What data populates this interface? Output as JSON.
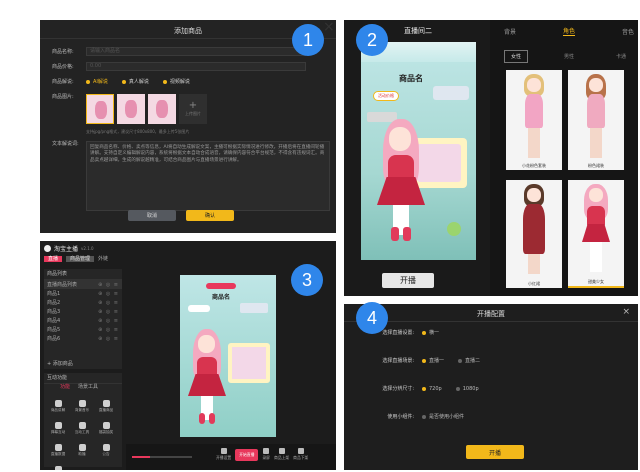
{
  "panel1": {
    "title": "添加商品",
    "name_label": "商品名称:",
    "name_placeholder": "请输入商品名",
    "price_label": "商品价格:",
    "price_placeholder": "0.00",
    "explain_label": "商品解说:",
    "explain_options": [
      "AI解说",
      "真人解说",
      "视频解说"
    ],
    "image_label": "商品图片:",
    "upload_label": "上传图片",
    "image_hint": "支持jpg/png格式，建议尺寸800x800，最多上传5张图片",
    "text_label": "文本解说词:",
    "text_content": "回复商品名称、价格、卖点等信息，AI将自动生成解说文案，主播可根据实际情况进行修改，开播后将在直播间轮播讲解。支持自定义编辑解说内容，系统将根据文本自动合成语音，请确保内容符合平台规范，不得含有违规词汇。商品卖点越详细，生成的解说越精准，可结合商品图片与直播场景进行讲解。",
    "cancel": "取消",
    "confirm": "确认",
    "close_icon": "close-icon"
  },
  "panel2": {
    "room_title": "直播间二",
    "product_name": "商品名",
    "sticker": "活动价格",
    "start_button": "开播",
    "tabs": [
      "背景",
      "角色",
      "音色"
    ],
    "active_tab": "角色",
    "sub_tabs": [
      "女性",
      "男性",
      "卡通"
    ],
    "roles": [
      {
        "label": "小花粉色套装"
      },
      {
        "label": "粉色裙装"
      },
      {
        "label": "小红裙"
      },
      {
        "label": "甜美少女"
      }
    ]
  },
  "panel3": {
    "app_title": "淘宝主播",
    "version": "v2.1.0",
    "tabs": [
      "直播",
      "商品管理",
      "外链"
    ],
    "list_header": "商品列表",
    "list_rows": [
      "直播商品列表",
      "商品1",
      "商品2",
      "商品3",
      "商品4",
      "商品5",
      "商品6"
    ],
    "add_button": "+ 添加商品",
    "section_title": "互动功能",
    "function_tabs": [
      "功能",
      "场景工具"
    ],
    "tools": [
      "商品讲解",
      "背景音乐",
      "直播商品",
      "弹幕互动",
      "互动工具",
      "福袋抽奖",
      "直播数据",
      "助播",
      "公告",
      "设置"
    ],
    "product_name": "商品名",
    "bottom_buttons": [
      "开播设置",
      "开始直播",
      "录屏",
      "商品上架",
      "商品下架"
    ],
    "start_live": "开始直播"
  },
  "panel4": {
    "title": "开播配置",
    "rows": [
      {
        "label": "选择直播设置:",
        "options": [
          "横一"
        ]
      },
      {
        "label": "选择直播场景:",
        "options": [
          "直播一",
          "直播二"
        ]
      },
      {
        "label": "选择分辨尺寸:",
        "options": [
          "720p",
          "1080p"
        ]
      },
      {
        "label": "使用小组件:",
        "options": [
          "是否使用小组件"
        ]
      }
    ],
    "start": "开播",
    "close_icon": "close-icon"
  },
  "badges": [
    "1",
    "2",
    "3",
    "4"
  ],
  "colors": {
    "accent": "#f2b81a",
    "badge": "#2f86ea",
    "panel_bg": "#1f1f1f",
    "live_pink": "#e8385c"
  }
}
